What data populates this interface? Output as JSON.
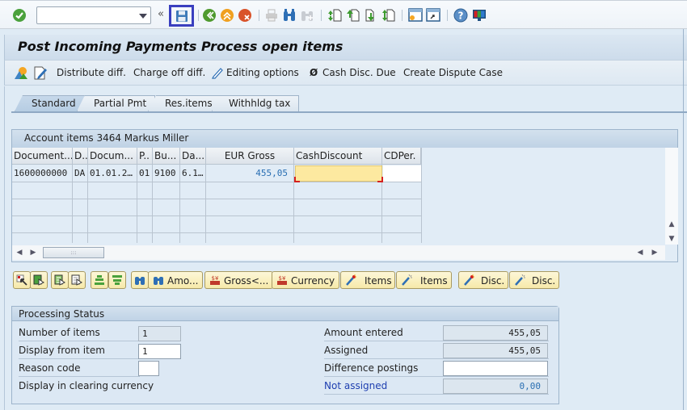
{
  "system_toolbar": {
    "command_field_value": "",
    "icons": [
      "enter-check-icon",
      "expand-double-chevron-icon",
      "save-icon",
      "back-icon",
      "exit-icon",
      "cancel-icon",
      "print-icon",
      "find-icon",
      "find-next-icon",
      "first-page-icon",
      "previous-page-icon",
      "next-page-icon",
      "last-page-icon",
      "new-session-icon",
      "create-shortcut-icon",
      "help-icon",
      "customize-layout-icon"
    ],
    "expand_label": "«"
  },
  "title": "Post Incoming Payments Process open items",
  "app_toolbar": {
    "buttons": [
      {
        "label": "Distribute diff."
      },
      {
        "label": "Charge off diff."
      },
      {
        "label": "Editing options"
      },
      {
        "label": "Cash Disc. Due",
        "glyph": "Ø"
      },
      {
        "label": "Create Dispute Case"
      }
    ]
  },
  "tabs": [
    {
      "label": "Standard",
      "active": true
    },
    {
      "label": "Partial Pmt",
      "active": false
    },
    {
      "label": "Res.items",
      "active": false
    },
    {
      "label": "Withhldg tax",
      "active": false
    }
  ],
  "account_items": {
    "title": "Account items 3464 Markus Miller",
    "columns": [
      "Document...",
      "D..",
      "Docum...",
      "P..",
      "Bu...",
      "Da...",
      "EUR Gross",
      "CashDiscount",
      "CDPer."
    ],
    "rows": [
      [
        "1600000000",
        "DA",
        "01.01.2…",
        "01",
        "9100",
        "6.1…",
        "455,05",
        "",
        ""
      ]
    ],
    "hscroll_thumb": ":::"
  },
  "action_buttons": [
    {
      "label": "Amo..."
    },
    {
      "label": "Gross<..."
    },
    {
      "label": "Currency"
    },
    {
      "label": "Items"
    },
    {
      "label": "Items"
    },
    {
      "label": "Disc."
    },
    {
      "label": "Disc."
    }
  ],
  "processing_status": {
    "title": "Processing Status",
    "number_of_items_label": "Number of items",
    "number_of_items_value": "1",
    "display_from_item_label": "Display from item",
    "display_from_item_value": "1",
    "reason_code_label": "Reason code",
    "reason_code_value": "",
    "display_clearing_currency_label": "Display in clearing currency",
    "amount_entered_label": "Amount entered",
    "amount_entered_value": "455,05",
    "assigned_label": "Assigned",
    "assigned_value": "455,05",
    "difference_postings_label": "Difference postings",
    "difference_postings_value": "",
    "not_assigned_label": "Not assigned",
    "not_assigned_value": "0,00"
  },
  "colors": {
    "highlight_cell": "#fde9a0",
    "amount_blue": "#2a6fb3",
    "link_blue": "#1e3fb0",
    "focus_border": "#3a3fbf"
  }
}
